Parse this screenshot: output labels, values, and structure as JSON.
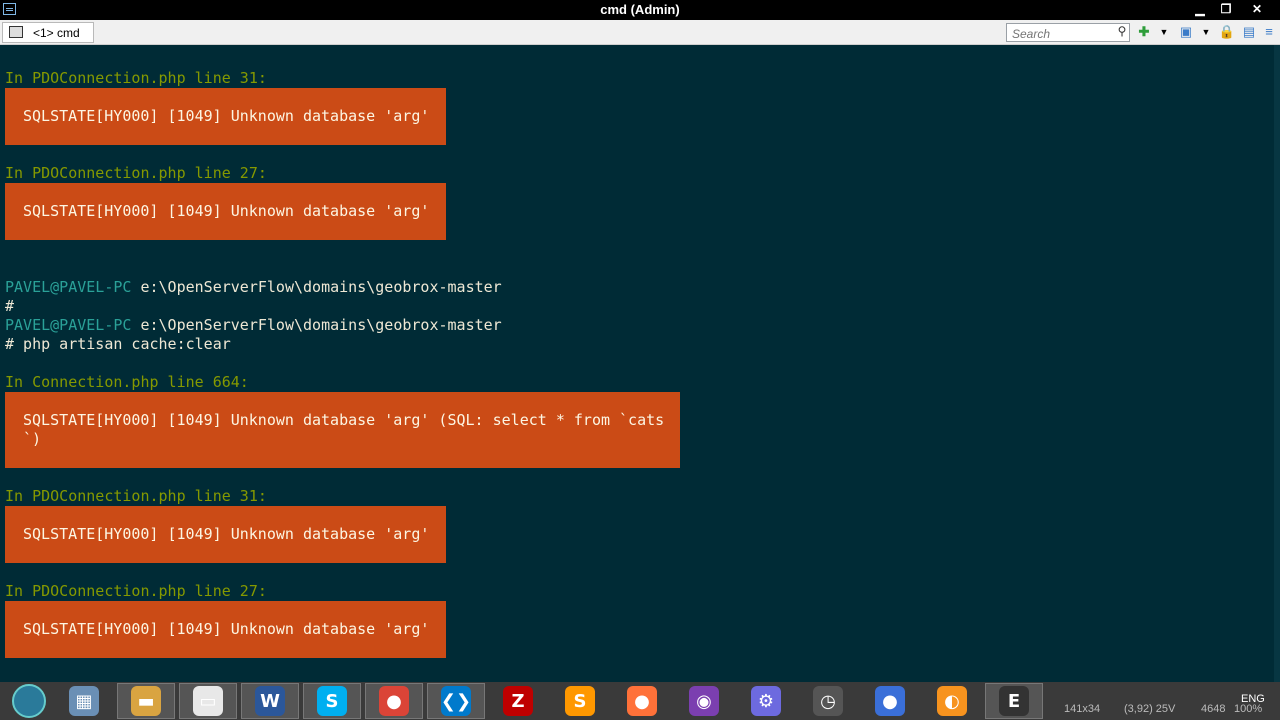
{
  "window": {
    "title": "cmd (Admin)"
  },
  "tab": {
    "label": "<1> cmd"
  },
  "search": {
    "placeholder": "Search"
  },
  "console": {
    "lines": [
      {
        "text": "In PDOConnection.php line 31:",
        "color": "green"
      },
      {
        "error": "SQLSTATE[HY000] [1049] Unknown database 'arg'"
      },
      {
        "text": "In PDOConnection.php line 27:",
        "color": "green"
      },
      {
        "error": "SQLSTATE[HY000] [1049] Unknown database 'arg'"
      },
      {
        "prompt_user": "PAVEL@PAVEL-PC",
        "prompt_path": "e:\\OpenServerFlow\\domains\\geobrox-master"
      },
      {
        "text": "#",
        "color": "white"
      },
      {
        "prompt_user": "PAVEL@PAVEL-PC",
        "prompt_path": "e:\\OpenServerFlow\\domains\\geobrox-master"
      },
      {
        "text": "# php artisan cache:clear",
        "color": "white"
      },
      {
        "text": "In Connection.php line 664:",
        "color": "green"
      },
      {
        "error_line1": "SQLSTATE[HY000] [1049] Unknown database 'arg' (SQL: select * from `cats",
        "error_line2": "`)"
      },
      {
        "text": "In PDOConnection.php line 31:",
        "color": "green"
      },
      {
        "error": "SQLSTATE[HY000] [1049] Unknown database 'arg'"
      },
      {
        "text": "In PDOConnection.php line 27:",
        "color": "green"
      },
      {
        "error": "SQLSTATE[HY000] [1049] Unknown database 'arg'"
      }
    ]
  },
  "statusbar": {
    "size": "141x34",
    "cursor": "(3,92) 25V",
    "count": "4648",
    "zoom": "100%",
    "lang": "ENG"
  },
  "taskbar": {
    "apps": [
      {
        "name": "calculator-icon",
        "glyph": "▦",
        "color": "#6a8fb5"
      },
      {
        "name": "file-explorer-icon",
        "glyph": "▬",
        "color": "#d9a441"
      },
      {
        "name": "folder-icon",
        "glyph": "▭",
        "color": "#e8e8e8"
      },
      {
        "name": "word-icon",
        "glyph": "W",
        "color": "#2b579a"
      },
      {
        "name": "skype-icon",
        "glyph": "S",
        "color": "#00aff0"
      },
      {
        "name": "chrome-icon",
        "glyph": "●",
        "color": "#db4437"
      },
      {
        "name": "vscode-icon",
        "glyph": "❮❯",
        "color": "#007acc"
      },
      {
        "name": "filezilla-icon",
        "glyph": "Z",
        "color": "#bf0000"
      },
      {
        "name": "sublime-icon",
        "glyph": "S",
        "color": "#ff9800"
      },
      {
        "name": "firefox-icon",
        "glyph": "●",
        "color": "#ff7139"
      },
      {
        "name": "podcast-icon",
        "glyph": "◉",
        "color": "#7b3fb0"
      },
      {
        "name": "settings-icon",
        "glyph": "⚙",
        "color": "#6d6adf"
      },
      {
        "name": "clock-icon",
        "glyph": "◷",
        "color": "#555555"
      },
      {
        "name": "firefox-dev-icon",
        "glyph": "●",
        "color": "#3a6fd8"
      },
      {
        "name": "uc-browser-icon",
        "glyph": "◐",
        "color": "#f7931e"
      },
      {
        "name": "conemu-icon",
        "glyph": "E",
        "color": "#333333"
      }
    ]
  }
}
